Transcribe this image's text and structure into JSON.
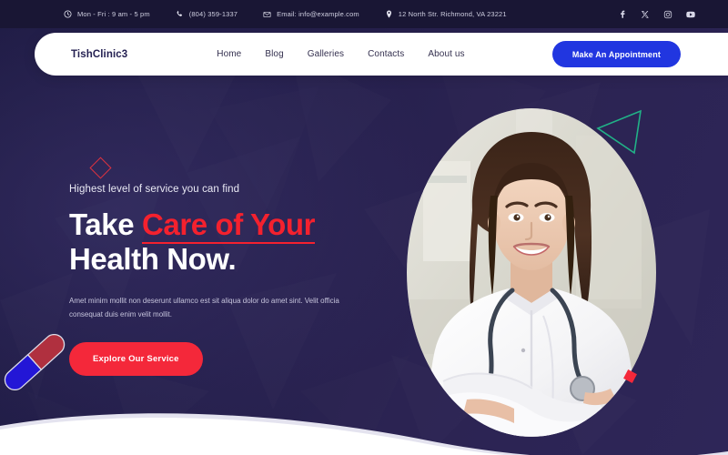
{
  "topbar": {
    "items": [
      {
        "icon": "clock-icon",
        "text": "Mon - Fri : 9 am - 5 pm"
      },
      {
        "icon": "phone-icon",
        "text": "(804) 359-1337"
      },
      {
        "icon": "envelope-icon",
        "text": "Email: info@example.com"
      },
      {
        "icon": "location-pin-icon",
        "text": "12 North Str. Richmond, VA 23221"
      }
    ],
    "social": [
      {
        "icon": "facebook-icon",
        "label": "Facebook"
      },
      {
        "icon": "x-twitter-icon",
        "label": "X"
      },
      {
        "icon": "instagram-icon",
        "label": "Instagram"
      },
      {
        "icon": "youtube-icon",
        "label": "YouTube"
      }
    ],
    "background_color": "#191634",
    "text_color": "#cfcfe0"
  },
  "navbar": {
    "brand": "TishClinic3",
    "links": [
      {
        "label": "Home"
      },
      {
        "label": "Blog"
      },
      {
        "label": "Galleries"
      },
      {
        "label": "Contacts"
      },
      {
        "label": "About us"
      }
    ],
    "cta_label": "Make An Appointment",
    "cta_color": "#2136e0",
    "background_color": "#ffffff"
  },
  "hero": {
    "eyebrow": "Highest level of service you can find",
    "headline_part1": "Take ",
    "headline_accent": "Care of Your",
    "headline_part2": "Health Now.",
    "paragraph": "Amet minim mollit non deserunt ullamco est sit aliqua dolor do amet sint. Velit officia consequat duis enim velit mollit.",
    "cta_label": "Explore Our Service",
    "cta_color": "#f4283a",
    "accent_color": "#f4212e",
    "background_color": "#2b2352",
    "image_alt": "Smiling female doctor in white coat with stethoscope, arms crossed"
  },
  "decorations": [
    {
      "name": "diamond-outline",
      "color": "#e0323f"
    },
    {
      "name": "triangle-outline",
      "color": "#21b187"
    },
    {
      "name": "small-square",
      "color": "#f4283a"
    },
    {
      "name": "capsule-pill",
      "color_left": "#2316d6",
      "color_right": "#b0303f"
    }
  ]
}
